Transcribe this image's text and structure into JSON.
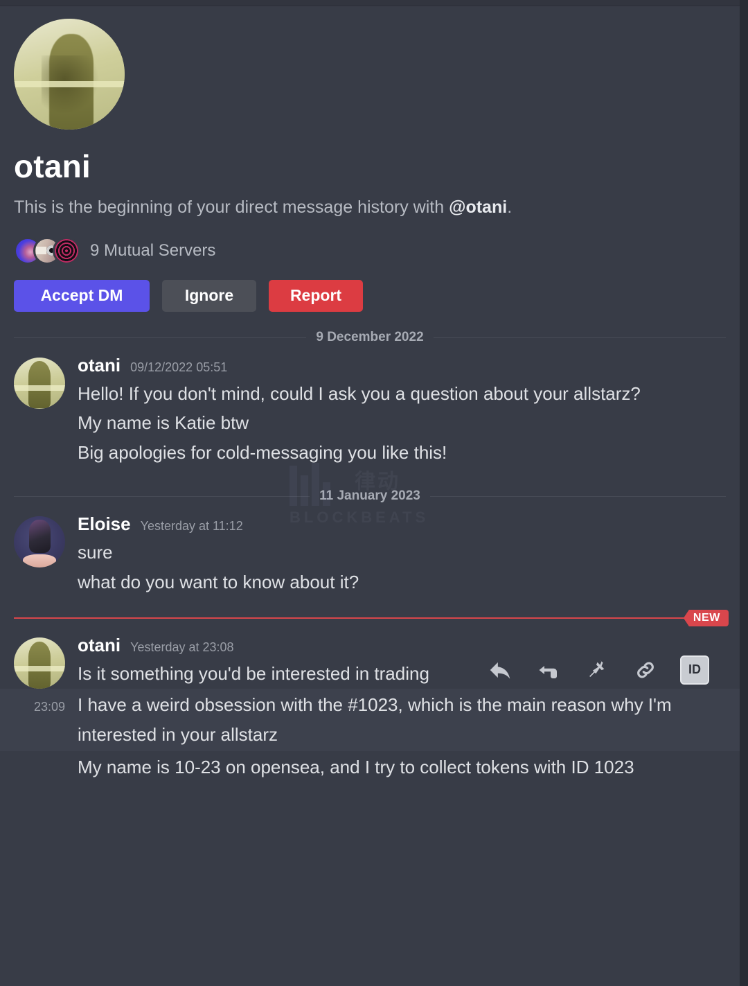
{
  "app": {
    "platform": "discord-dm"
  },
  "intro": {
    "username": "otani",
    "beginning_prefix": "This is the beginning of your direct message history with ",
    "beginning_mention": "@otani",
    "beginning_suffix": ".",
    "mutual_servers_label": "9 Mutual Servers",
    "buttons": {
      "accept": "Accept DM",
      "ignore": "Ignore",
      "report": "Report"
    },
    "colors": {
      "accept": "#5b52e8",
      "ignore": "#4c4f57",
      "report": "#dc3c42"
    }
  },
  "dividers": {
    "date_1": "9 December 2022",
    "date_2": "11 January 2023",
    "new_badge": "NEW",
    "new_color": "#d9464c"
  },
  "groups": [
    {
      "author": "otani",
      "timestamp": "09/12/2022 05:51",
      "avatar": "otani-avatar",
      "lines": [
        "Hello! If you don't mind, could I ask you a question about your allstarz?",
        "My name is Katie btw",
        "Big apologies for cold-messaging you like this!"
      ]
    },
    {
      "author": "Eloise",
      "timestamp": "Yesterday at 11:12",
      "avatar": "eloise-avatar",
      "lines": [
        "sure",
        "what do you want to know about it?"
      ]
    },
    {
      "author": "otani",
      "timestamp": "Yesterday at 23:08",
      "avatar": "otani-avatar",
      "lines": [
        "Is it something you'd be interested in trading"
      ]
    }
  ],
  "follow_up": {
    "gutter_time": "23:09",
    "lines": [
      "I have a weird obsession with the #1023, which is the main reason why I'm interested in your allstarz",
      "My name is 10-23 on opensea, and I try to collect tokens with ID 1023"
    ]
  },
  "hover_toolbar": {
    "icons": [
      "reply-icon",
      "marker-icon",
      "pin-icon",
      "link-icon"
    ],
    "id_label": "ID"
  },
  "watermark": {
    "text": "BLOCKBEATS",
    "cn": "律动"
  }
}
